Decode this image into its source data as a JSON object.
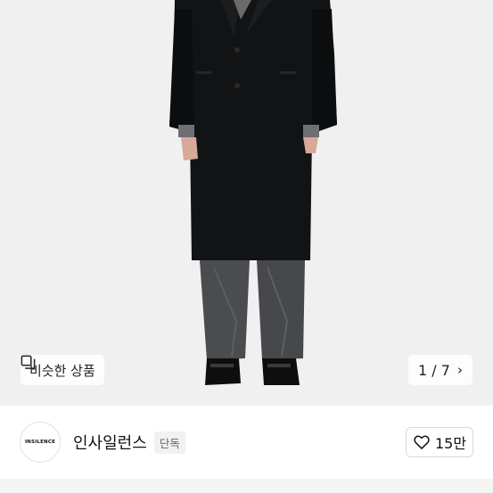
{
  "product_images": {
    "similar_products_label": "비슷한 상품",
    "current_page": "1",
    "separator": "/",
    "total_pages": "7"
  },
  "store": {
    "logo_text": "INSILENCE",
    "name": "인사일런스",
    "tag": "단독",
    "likes": "15만"
  }
}
